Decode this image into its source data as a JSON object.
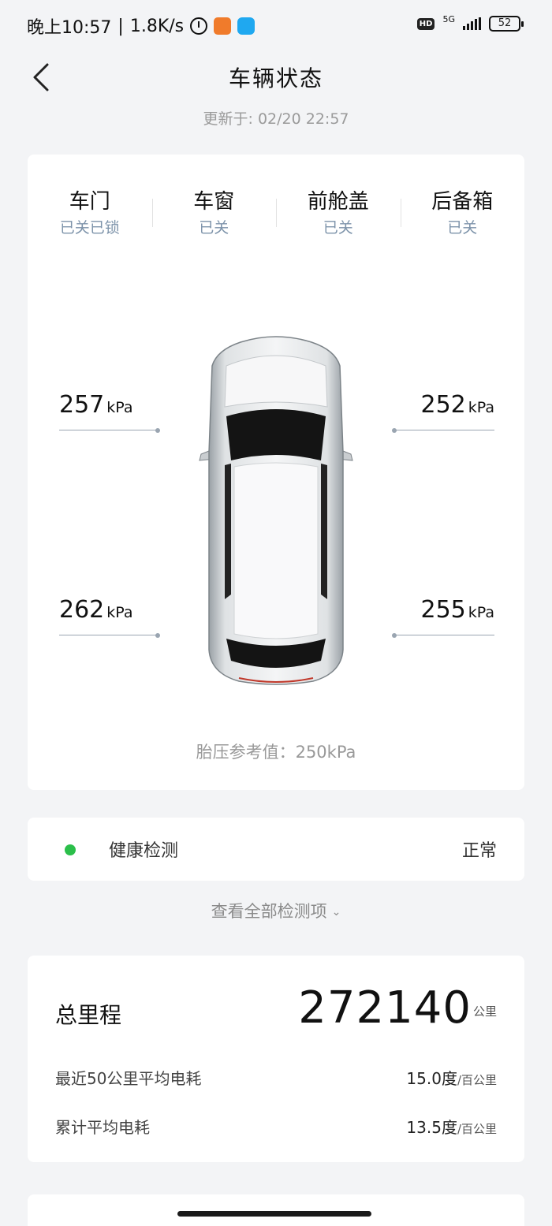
{
  "status_bar": {
    "time": "晚上10:57",
    "speed": "1.8K/s",
    "hd": "HD",
    "network": "5G",
    "battery": "52"
  },
  "header": {
    "title": "车辆状态",
    "updated": "更新于: 02/20 22:57"
  },
  "vehicle_status": [
    {
      "label": "车门",
      "value": "已关已锁"
    },
    {
      "label": "车窗",
      "value": "已关"
    },
    {
      "label": "前舱盖",
      "value": "已关"
    },
    {
      "label": "后备箱",
      "value": "已关"
    }
  ],
  "tires": {
    "front_left": "257",
    "front_right": "252",
    "rear_left": "262",
    "rear_right": "255",
    "unit": "kPa",
    "reference": "胎压参考值：250kPa"
  },
  "health": {
    "label": "健康检测",
    "value": "正常",
    "status_color": "#2bbf4a"
  },
  "view_all": "查看全部检测项",
  "mileage": {
    "total_label": "总里程",
    "total_value": "272140",
    "total_unit": "公里",
    "rows": [
      {
        "label": "最近50公里平均电耗",
        "value": "15.0度",
        "unit": "/百公里"
      },
      {
        "label": "累计平均电耗",
        "value": "13.5度",
        "unit": "/百公里"
      }
    ]
  }
}
